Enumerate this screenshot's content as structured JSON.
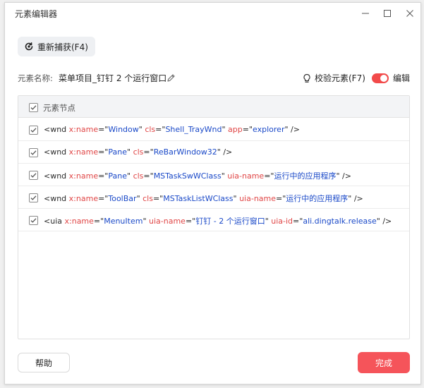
{
  "window": {
    "title": "元素编辑器"
  },
  "toolbar": {
    "recapture_label": "重新捕获(F4)"
  },
  "element_name": {
    "label": "元素名称:",
    "value": "菜单项目_钉钉  2 个运行窗口"
  },
  "verify": {
    "label": "校验元素(F7)"
  },
  "edit_toggle": {
    "label": "编辑",
    "on": true,
    "color": "#f24a4a"
  },
  "tree": {
    "header_label": "元素节点",
    "header_checked": true,
    "nodes": [
      {
        "checked": true,
        "tag": "wnd",
        "attrs": [
          {
            "name": "x:name",
            "value": "Window"
          },
          {
            "name": "cls",
            "value": "Shell_TrayWnd"
          },
          {
            "name": "app",
            "value": "explorer"
          }
        ]
      },
      {
        "checked": true,
        "tag": "wnd",
        "attrs": [
          {
            "name": "x:name",
            "value": "Pane"
          },
          {
            "name": "cls",
            "value": "ReBarWindow32"
          }
        ]
      },
      {
        "checked": true,
        "tag": "wnd",
        "attrs": [
          {
            "name": "x:name",
            "value": "Pane"
          },
          {
            "name": "cls",
            "value": "MSTaskSwWClass"
          },
          {
            "name": "uia-name",
            "value": "运行中的应用程序"
          }
        ]
      },
      {
        "checked": true,
        "tag": "wnd",
        "attrs": [
          {
            "name": "x:name",
            "value": "ToolBar"
          },
          {
            "name": "cls",
            "value": "MSTaskListWClass"
          },
          {
            "name": "uia-name",
            "value": "运行中的应用程序"
          }
        ]
      },
      {
        "checked": true,
        "tag": "uia",
        "attrs": [
          {
            "name": "x:name",
            "value": "MenuItem"
          },
          {
            "name": "uia-name",
            "value": "钉钉 - 2 个运行窗口"
          },
          {
            "name": "uia-id",
            "value": "ali.dingtalk.release"
          }
        ]
      }
    ]
  },
  "footer": {
    "help_label": "帮助",
    "done_label": "完成"
  },
  "colors": {
    "accent": "#f5545a",
    "attr": "#e04646",
    "value": "#1a49c8"
  }
}
